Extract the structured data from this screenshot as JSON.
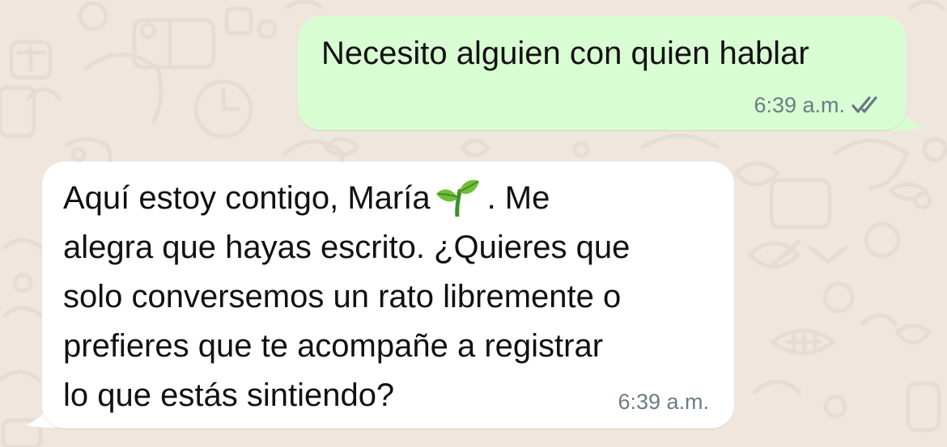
{
  "messages": {
    "outgoing": {
      "text": "Necesito alguien con quien hablar",
      "time": "6:39 a.m.",
      "status_icon": "double-check-icon"
    },
    "incoming": {
      "text_part1": "Aquí estoy contigo, María",
      "emoji": "seedling-icon",
      "text_part2": ". Me\nalegra que hayas escrito. ¿Quieres que\nsolo conversemos un rato libremente o\nprefieres que te acompañe a registrar\nlo que estás sintiendo?",
      "time": "6:39 a.m."
    }
  },
  "colors": {
    "background": "#efe7de",
    "outgoing_bubble": "#d9fdd3",
    "incoming_bubble": "#ffffff",
    "meta_text": "#6b7c85"
  }
}
